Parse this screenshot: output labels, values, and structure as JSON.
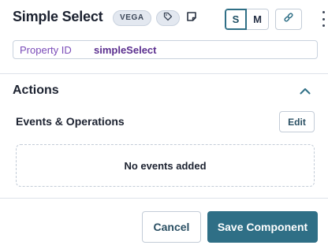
{
  "header": {
    "title": "Simple Select",
    "badge": "VEGA",
    "tag_icon": "tag-icon",
    "note_icon": "note-icon",
    "sizes": [
      "S",
      "M"
    ],
    "selected_size": "S",
    "link_icon": "link-icon",
    "menu_icon": "kebab-menu-icon"
  },
  "property": {
    "label": "Property ID",
    "value": "simpleSelect"
  },
  "actions": {
    "title": "Actions",
    "collapse_icon": "chevron-up-icon",
    "events_label": "Events & Operations",
    "edit_label": "Edit",
    "empty_text": "No events added"
  },
  "footer": {
    "cancel_label": "Cancel",
    "save_label": "Save Component"
  },
  "colors": {
    "primary": "#2f6f86",
    "property_label": "#7a4bb8",
    "property_value": "#5b2f8f",
    "badge_bg": "#e3e8f0"
  }
}
